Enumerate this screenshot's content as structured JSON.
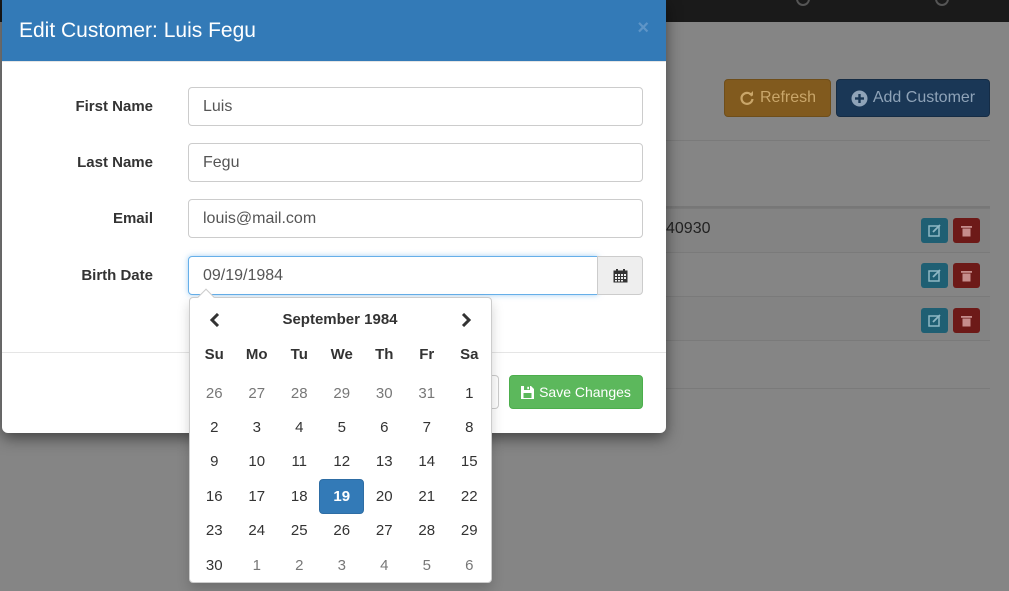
{
  "background": {
    "refresh_label": "Refresh",
    "add_customer_label": "Add Customer",
    "row_text": "40930"
  },
  "modal": {
    "title": "Edit Customer: Luis Fegu",
    "close_glyph": "×",
    "fields": {
      "first_name": {
        "label": "First Name",
        "value": "Luis"
      },
      "last_name": {
        "label": "Last Name",
        "value": "Fegu"
      },
      "email": {
        "label": "Email",
        "value": "louis@mail.com"
      },
      "birth_date": {
        "label": "Birth Date",
        "value": "09/19/1984"
      }
    },
    "save_label": "Save Changes"
  },
  "datepicker": {
    "month_label": "September 1984",
    "weekdays": [
      "Su",
      "Mo",
      "Tu",
      "We",
      "Th",
      "Fr",
      "Sa"
    ],
    "weeks": [
      [
        {
          "d": "26",
          "old": true
        },
        {
          "d": "27",
          "old": true
        },
        {
          "d": "28",
          "old": true
        },
        {
          "d": "29",
          "old": true
        },
        {
          "d": "30",
          "old": true
        },
        {
          "d": "31",
          "old": true
        },
        {
          "d": "1"
        }
      ],
      [
        {
          "d": "2"
        },
        {
          "d": "3"
        },
        {
          "d": "4"
        },
        {
          "d": "5"
        },
        {
          "d": "6"
        },
        {
          "d": "7"
        },
        {
          "d": "8"
        }
      ],
      [
        {
          "d": "9"
        },
        {
          "d": "10"
        },
        {
          "d": "11"
        },
        {
          "d": "12"
        },
        {
          "d": "13"
        },
        {
          "d": "14"
        },
        {
          "d": "15"
        }
      ],
      [
        {
          "d": "16"
        },
        {
          "d": "17"
        },
        {
          "d": "18"
        },
        {
          "d": "19",
          "active": true
        },
        {
          "d": "20"
        },
        {
          "d": "21"
        },
        {
          "d": "22"
        }
      ],
      [
        {
          "d": "23"
        },
        {
          "d": "24"
        },
        {
          "d": "25"
        },
        {
          "d": "26"
        },
        {
          "d": "27"
        },
        {
          "d": "28"
        },
        {
          "d": "29"
        }
      ],
      [
        {
          "d": "30"
        },
        {
          "d": "1",
          "old": true
        },
        {
          "d": "2",
          "old": true
        },
        {
          "d": "3",
          "old": true
        },
        {
          "d": "4",
          "old": true
        },
        {
          "d": "5",
          "old": true
        },
        {
          "d": "6",
          "old": true
        }
      ]
    ]
  },
  "colors": {
    "primary": "#337ab7",
    "success": "#5cb85c",
    "warning": "#f0ad4e",
    "danger": "#d9534f",
    "info": "#5bc0de"
  },
  "icons": {
    "refresh": "refresh-icon",
    "add": "plus-circle-icon",
    "calendar": "calendar-icon",
    "save": "floppy-disk-icon",
    "edit": "edit-icon",
    "delete": "trash-icon",
    "prev": "chevron-left-icon",
    "next": "chevron-right-icon"
  }
}
